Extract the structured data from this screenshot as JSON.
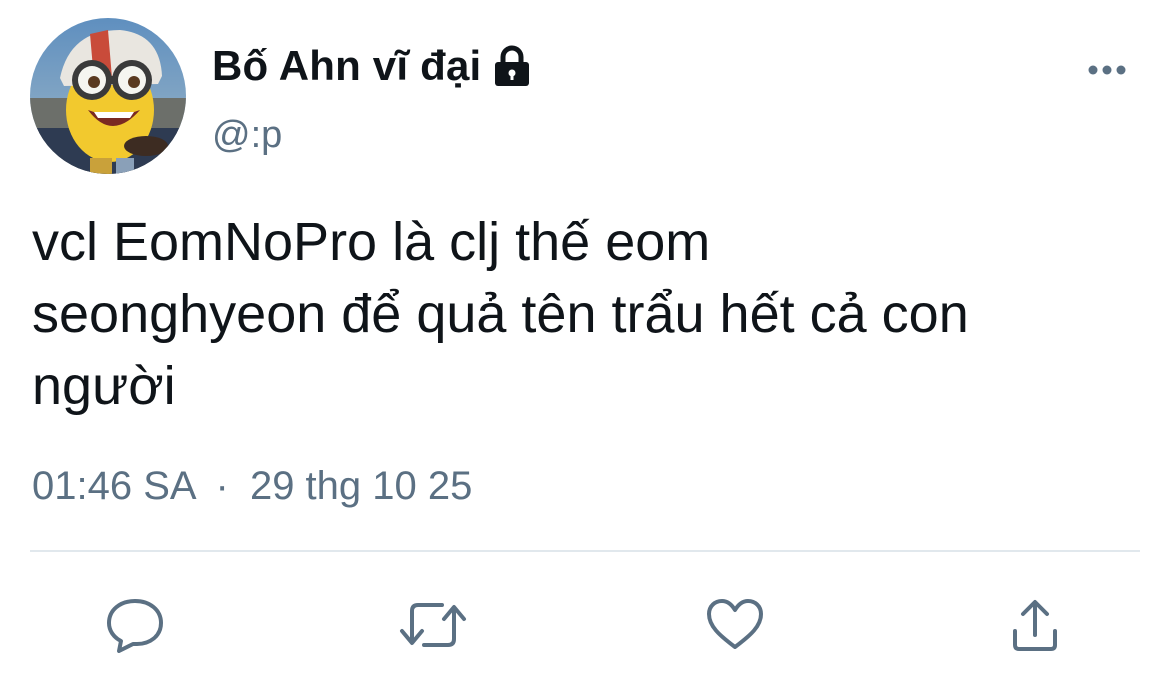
{
  "tweet": {
    "display_name": "Bố Ahn vĩ đại",
    "handle": "@:p",
    "protected_icon": "lock-icon",
    "text": "vcl EomNoPro là clj thế eom\nseonghyeon để quả tên trẩu hết cả con\nngười",
    "time": "01:46 SA",
    "separator": "·",
    "date": "29 thg 10 25"
  },
  "header": {
    "more_icon": "more-horizontal-icon"
  },
  "actions": [
    {
      "name": "reply",
      "icon": "reply-icon"
    },
    {
      "name": "retweet",
      "icon": "retweet-icon"
    },
    {
      "name": "like",
      "icon": "heart-icon"
    },
    {
      "name": "share",
      "icon": "share-icon"
    }
  ],
  "colors": {
    "text_primary": "#0f1419",
    "text_secondary": "#5b7083",
    "divider": "#e1e8ed",
    "icon": "#5b7083"
  }
}
